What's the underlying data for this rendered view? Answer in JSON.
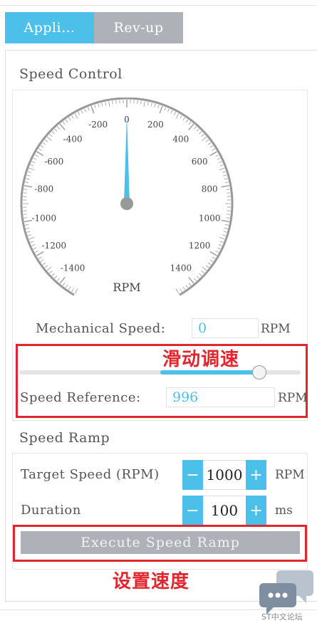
{
  "tabs": [
    {
      "label": "Appli…",
      "active": true
    },
    {
      "label": "Rev-up",
      "active": false
    }
  ],
  "speed_control": {
    "title": "Speed Control",
    "gauge": {
      "min": -1500,
      "max": 1500,
      "labels": [
        -1400,
        -1200,
        -1000,
        -800,
        -600,
        -400,
        -200,
        0,
        200,
        400,
        600,
        800,
        1000,
        1200,
        1400
      ],
      "unit": "RPM",
      "needle_value": 0,
      "needle_color": "#4dc0ea"
    },
    "mechanical_speed_label": "Mechanical Speed:",
    "mechanical_speed_value": "0",
    "mechanical_speed_unit": "RPM",
    "slider_value": 996,
    "speed_reference_label": "Speed Reference:",
    "speed_reference_value": "996",
    "speed_reference_unit": "RPM",
    "annotation": "滑动调速"
  },
  "speed_ramp": {
    "title": "Speed Ramp",
    "target_label": "Target Speed (RPM)",
    "target_value": "1000",
    "target_unit": "RPM",
    "duration_label": "Duration",
    "duration_value": "100",
    "duration_unit": "ms",
    "minus": "−",
    "plus": "+",
    "execute_label": "Execute Speed Ramp",
    "annotation": "设置速度"
  },
  "watermark": {
    "text": "ST中文论坛",
    "icon": "chat-bubbles-icon"
  },
  "colors": {
    "accent": "#4dc0ea",
    "annotation": "#e0262e",
    "inactive": "#aeb2b8"
  }
}
